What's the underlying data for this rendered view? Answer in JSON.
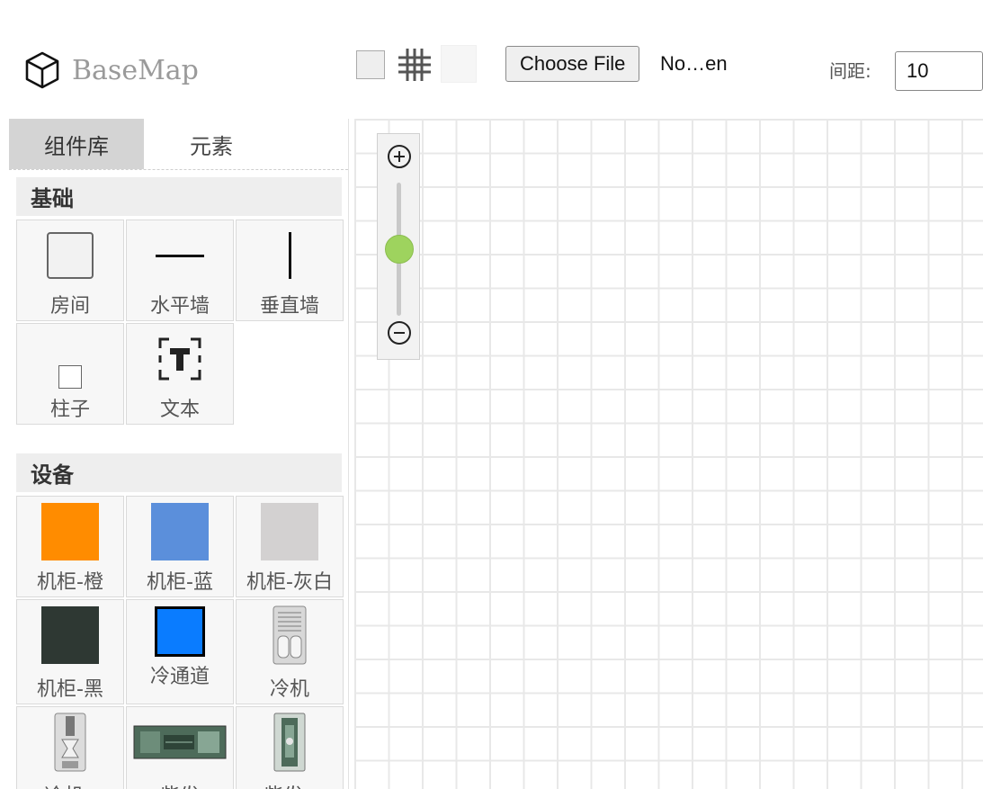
{
  "header": {
    "app_title": "BaseMap",
    "file_button_label": "Choose File",
    "file_name": "No…en",
    "spacing_label": "间距:",
    "spacing_value": "10"
  },
  "sidebar": {
    "tabs": [
      {
        "label": "组件库",
        "active": true
      },
      {
        "label": "元素",
        "active": false
      }
    ],
    "sections": [
      {
        "title": "基础",
        "items": [
          {
            "label": "房间",
            "icon": "room-icon"
          },
          {
            "label": "水平墙",
            "icon": "horizontal-wall-icon"
          },
          {
            "label": "垂直墙",
            "icon": "vertical-wall-icon"
          },
          {
            "label": "柱子",
            "icon": "pillar-icon"
          },
          {
            "label": "文本",
            "icon": "text-icon"
          }
        ]
      },
      {
        "title": "设备",
        "items": [
          {
            "label": "机柜-橙",
            "color": "#FF8C00"
          },
          {
            "label": "机柜-蓝",
            "color": "#5B8FDB"
          },
          {
            "label": "机柜-灰白",
            "color": "#D3D1D1"
          },
          {
            "label": "机柜-黑",
            "color": "#2E3833"
          },
          {
            "label": "冷通道",
            "color": "#0A7CFF"
          },
          {
            "label": "冷机",
            "icon": "chiller-icon"
          },
          {
            "label": "冷机a",
            "icon": "chiller-a-icon"
          },
          {
            "label": "柴发",
            "icon": "diesel-generator-icon"
          },
          {
            "label": "柴发a",
            "icon": "diesel-generator-a-icon"
          }
        ]
      }
    ]
  },
  "canvas": {
    "grid_spacing": "10",
    "zoom_level": 0.5,
    "zoom_in_icon": "plus-circle-icon",
    "zoom_out_icon": "minus-circle-icon"
  }
}
